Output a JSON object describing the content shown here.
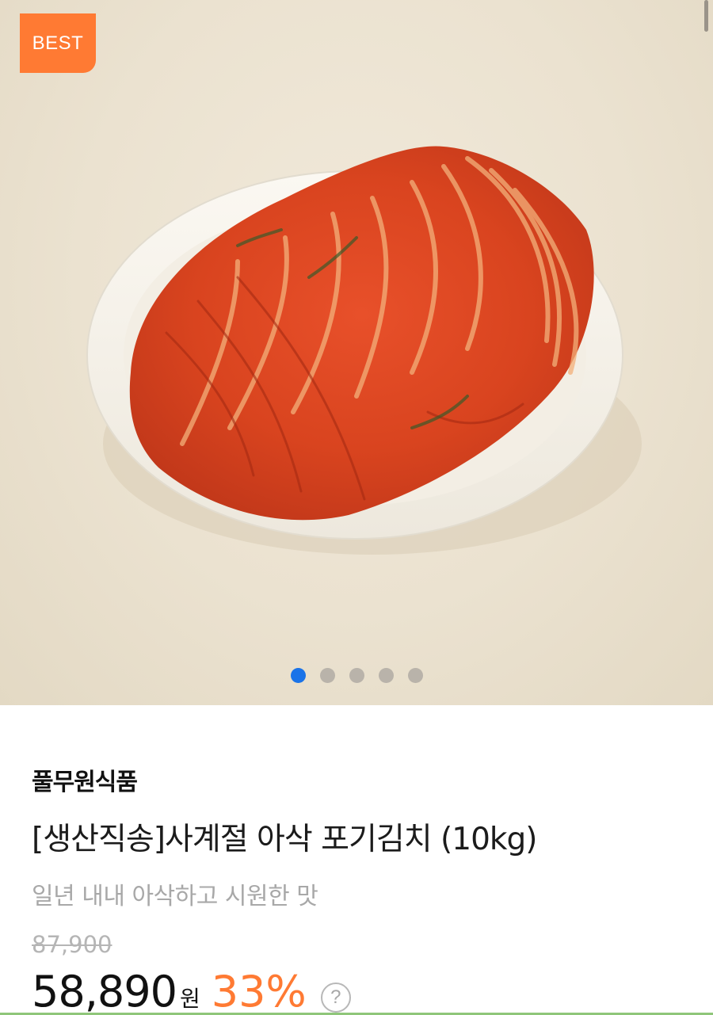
{
  "gallery": {
    "badge": "BEST",
    "image_description_icon": "kimchi-product-photo",
    "slide_count": 5,
    "active_slide": 1
  },
  "product": {
    "brand": "풀무원식품",
    "title": "[생산직송]사계절 아삭 포기김치 (10kg)",
    "subtitle": "일년 내내 아삭하고 시원한 맛",
    "original_price": "87,900",
    "sale_price": "58,890",
    "currency": "원",
    "discount": "33%",
    "help_icon": "question-circle-icon"
  },
  "colors": {
    "accent": "#ff7a33",
    "active_dot": "#1a73e8",
    "inactive_dot": "#b9b3aa"
  }
}
